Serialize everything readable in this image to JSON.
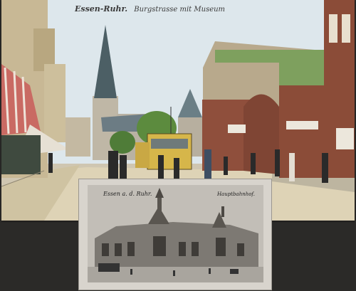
{
  "top_postcard": {
    "location": "Essen-Ruhr.",
    "subtitle": "Burgstrasse mit Museum"
  },
  "bottom_postcard": {
    "location": "Essen a. d. Ruhr.",
    "subtitle": "Hauptbahnhof."
  },
  "colors": {
    "sky": "#dde7ec",
    "road": "#ded3b6",
    "tram": "#d6b64a",
    "trees": "#5c8b3e",
    "facade_red": "#8f4f3c",
    "roof_green": "#7ea05e",
    "mono_bg": "#bdb9b2"
  }
}
